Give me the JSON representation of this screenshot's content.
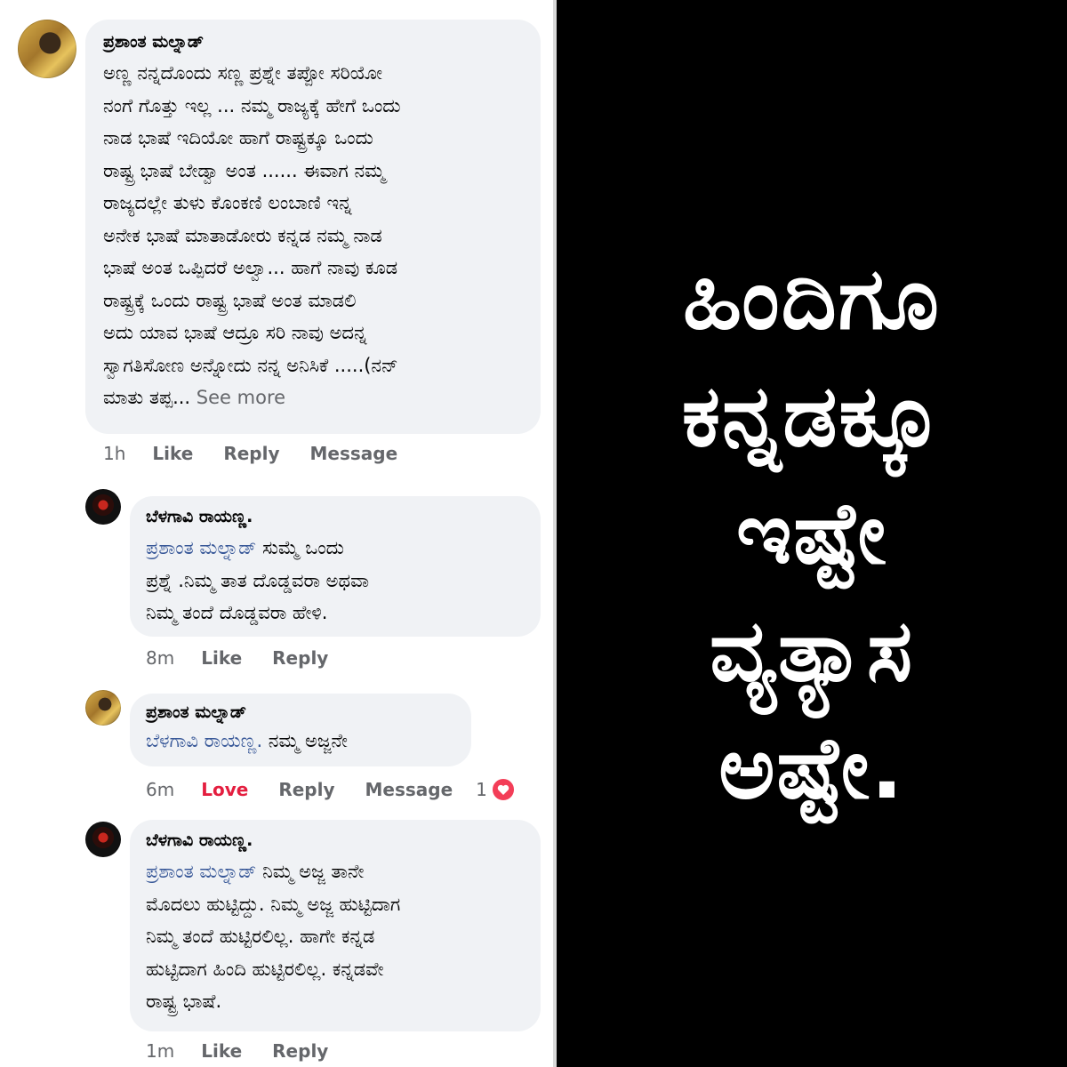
{
  "comments": [
    {
      "author": "ಪ್ರಶಾಂತ ಮಲ್ನಾಡ್",
      "lines": [
        "ಅಣ್ಣ ನನ್ನದೊಂದು ಸಣ್ಣ ಪ್ರಶ್ನೇ ತಪ್ಪೋ ಸರಿಯೋ",
        "ನಂಗೆ ಗೊತ್ತು ಇಲ್ಲ ... ನಮ್ಮ ರಾಜ್ಯಕ್ಕೆ ಹೇಗೆ ಒಂದು",
        "ನಾಡ ಭಾಷೆ ಇದಿಯೋ ಹಾಗೆ ರಾಷ್ಟ್ರಕ್ಕೂ ಒಂದು",
        "ರಾಷ್ಟ್ರ ಭಾಷೆ ಬೇಡ್ವಾ ಅಂತ ...... ಈವಾಗ ನಮ್ಮ",
        "ರಾಜ್ಯದಲ್ಲೇ   ತುಳು ಕೊಂಕಣಿ ಲಂಬಾಣಿ ಇನ್ನ",
        "ಅನೇಕ ಭಾಷೆ ಮಾತಾಡೋರು ಕನ್ನಡ ನಮ್ಮ ನಾಡ",
        "ಭಾಷೆ ಅಂತ ಒಪ್ಪಿದರೆ ಅಲ್ವಾ... ಹಾಗೆ ನಾವು ಕೂಡ",
        "ರಾಷ್ಟ್ರಕ್ಕೆ ಒಂದು ರಾಷ್ಟ್ರ ಭಾಷೆ ಅಂತ ಮಾಡಲಿ",
        "ಅದು ಯಾವ ಭಾಷೆ ಆದ್ರೂ ಸರಿ ನಾವು ಅದನ್ನ",
        "ಸ್ವಾಗತಿಸೋಣ ಅನ್ನೋದು ನನ್ನ ಅನಿಸಿಕೆ .....(ನನ್"
      ],
      "last_line": "ಮಾತು ತಪ್ಪ...",
      "see_more": "See more",
      "time": "1h",
      "like": "Like",
      "reply": "Reply",
      "message": "Message"
    },
    {
      "author": "ಬೆಳಗಾವಿ ರಾಯಣ್ಣ.",
      "mention": "ಪ್ರಶಾಂತ ಮಲ್ನಾಡ್",
      "first_rest": " ಸುಮ್ಮೆ ಒಂದು",
      "lines": [
        "ಪ್ರಶ್ನೆ .ನಿಮ್ಮ ತಾತ ದೊಡ್ಡವರಾ ಅಥವಾ",
        "ನಿಮ್ಮ ತಂದೆ ದೊಡ್ಡವರಾ ಹೇಳಿ."
      ],
      "time": "8m",
      "like": "Like",
      "reply": "Reply"
    },
    {
      "author": "ಪ್ರಶಾಂತ ಮಲ್ನಾಡ್",
      "mention": "ಬೆಳಗಾವಿ ರಾಯಣ್ಣ.",
      "first_rest": "  ನಮ್ಮ ಅಜ್ಜನೇ",
      "time": "6m",
      "love": "Love",
      "reply": "Reply",
      "message": "Message",
      "reaction_count": "1"
    },
    {
      "author": "ಬೆಳಗಾವಿ ರಾಯಣ್ಣ.",
      "mention": "ಪ್ರಶಾಂತ ಮಲ್ನಾಡ್",
      "first_rest": " ನಿಮ್ಮ ಅಜ್ಜ ತಾನೇ",
      "lines": [
        "ಮೊದಲು ಹುಟ್ಟಿದ್ದು. ನಿಮ್ಮ ಅಜ್ಜ ಹುಟ್ಟಿದಾಗ",
        "ನಿಮ್ಮ ತಂದೆ ಹುಟ್ಟಿರಲಿಲ್ಲ. ಹಾಗೇ ಕನ್ನಡ",
        "ಹುಟ್ಟಿದಾಗ ಹಿಂದಿ ಹುಟ್ಟಿರಲಿಲ್ಲ. ಕನ್ನಡವೇ",
        "ರಾಷ್ಟ್ರ ಭಾಷೆ."
      ],
      "time": "1m",
      "like": "Like",
      "reply": "Reply"
    }
  ],
  "banner": {
    "lines": [
      "ಹಿಂದಿಗೂ",
      "ಕನ್ನಡಕ್ಕೂ",
      "ಇಷ್ಟೇ",
      "ವ್ಯತ್ಯಾಸ",
      "ಅಷ್ಟೇ."
    ]
  },
  "colors": {
    "bubble": "#f0f2f5",
    "mention": "#385898",
    "meta": "#65676b",
    "love": "#e41e3f",
    "banner_bg": "#000000",
    "banner_text": "#ffffff"
  }
}
